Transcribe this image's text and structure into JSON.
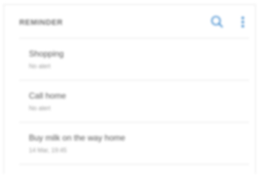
{
  "app": {
    "title": "REMINDER",
    "accent_color": "#2c7fc9",
    "icons": {
      "search": "search-icon",
      "more": "more-options-icon"
    }
  },
  "reminders": [
    {
      "title": "Shopping",
      "subtitle": "No alert"
    },
    {
      "title": "Call home",
      "subtitle": "No alert"
    },
    {
      "title": "Buy milk on the way home",
      "subtitle": "14 Mar, 19:45"
    }
  ]
}
